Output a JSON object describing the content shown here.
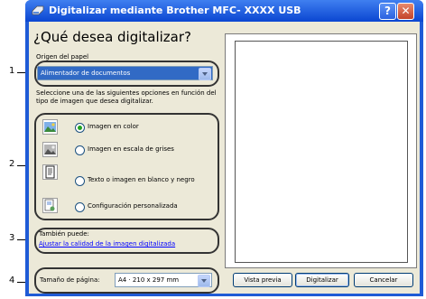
{
  "window": {
    "title": "Digitalizar mediante Brother MFC- XXXX USB",
    "help_label": "?",
    "close_label": "✕"
  },
  "heading": "¿Qué desea digitalizar?",
  "source": {
    "label": "Origen del papel",
    "value": "Alimentador de documentos"
  },
  "instructions": "Seleccione una de las siguientes opciones en función del tipo de imagen que desea digitalizar.",
  "options": [
    {
      "label": "Imagen en color",
      "selected": true,
      "icon": "color-image-icon"
    },
    {
      "label": "Imagen en escala de grises",
      "selected": false,
      "icon": "grayscale-image-icon"
    },
    {
      "label": "Texto o imagen en blanco y negro",
      "selected": false,
      "icon": "bw-text-icon"
    },
    {
      "label": "Configuración personalizada",
      "selected": false,
      "icon": "custom-settings-icon"
    }
  ],
  "also": {
    "label": "También puede:",
    "link": "Ajustar la calidad de la imagen digitalizada"
  },
  "page_size": {
    "label": "Tamaño de página:",
    "value": "A4 · 210 x 297 mm"
  },
  "buttons": {
    "preview": "Vista previa",
    "scan": "Digitalizar",
    "cancel": "Cancelar"
  },
  "callouts": [
    "1",
    "2",
    "3",
    "4"
  ],
  "colors": {
    "titlebar": "#0b46d1",
    "selection": "#316ac5",
    "radio_selected": "#21a121",
    "link": "#0000ff"
  }
}
